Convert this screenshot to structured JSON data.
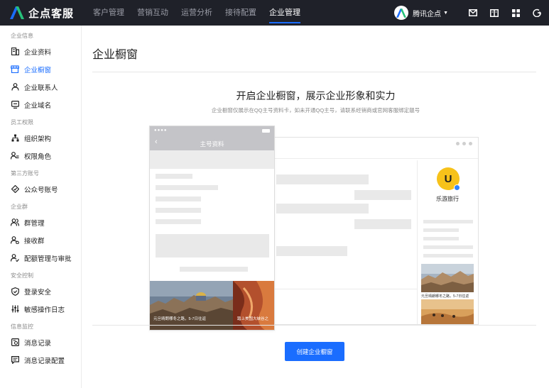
{
  "brand": {
    "name": "企点客服"
  },
  "nav": [
    {
      "label": "客户管理",
      "active": false
    },
    {
      "label": "营销互动",
      "active": false
    },
    {
      "label": "运营分析",
      "active": false
    },
    {
      "label": "接待配置",
      "active": false
    },
    {
      "label": "企业管理",
      "active": true
    }
  ],
  "account": {
    "name": "腾讯企点"
  },
  "top_icons": [
    "mail-icon",
    "book-icon",
    "grid-icon",
    "logout-icon"
  ],
  "sidebar": {
    "groups": [
      {
        "title": "企业信息",
        "items": [
          {
            "label": "企业资料",
            "icon": "profile-icon",
            "active": false
          },
          {
            "label": "企业橱窗",
            "icon": "storefront-icon",
            "active": true
          },
          {
            "label": "企业联系人",
            "icon": "contacts-icon",
            "active": false
          },
          {
            "label": "企业域名",
            "icon": "domain-icon",
            "active": false
          }
        ]
      },
      {
        "title": "员工权限",
        "items": [
          {
            "label": "组织架构",
            "icon": "org-chart-icon",
            "active": false
          },
          {
            "label": "权限角色",
            "icon": "role-icon",
            "active": false
          }
        ]
      },
      {
        "title": "第三方账号",
        "items": [
          {
            "label": "公众号账号",
            "icon": "official-account-icon",
            "active": false
          }
        ]
      },
      {
        "title": "企业群",
        "items": [
          {
            "label": "群管理",
            "icon": "group-icon",
            "active": false
          },
          {
            "label": "接收群",
            "icon": "receive-group-icon",
            "active": false
          },
          {
            "label": "配额管理与审批",
            "icon": "quota-icon",
            "active": false
          }
        ]
      },
      {
        "title": "安全控制",
        "items": [
          {
            "label": "登录安全",
            "icon": "shield-icon",
            "active": false
          },
          {
            "label": "敏感操作日志",
            "icon": "log-icon",
            "active": false
          }
        ]
      },
      {
        "title": "信息监控",
        "items": [
          {
            "label": "消息记录",
            "icon": "message-record-icon",
            "active": false
          },
          {
            "label": "消息记录配置",
            "icon": "message-config-icon",
            "active": false
          }
        ]
      }
    ]
  },
  "main": {
    "title": "企业橱窗",
    "hero_title": "开启企业橱窗，展示企业形象和实力",
    "hero_subtitle": "企业橱窗仅展示在QQ主号资料卡，如未开通QQ主号，请联系经销商或官网客服绑定靓号",
    "phone_title": "主号资料",
    "card_name": "乐游旅行",
    "card_logo": "U",
    "card_caption": "元旦晴朗哪冬之路，5-7日往返",
    "strip_caption_1": "元旦晴朗哪冬之路，5-7日往返",
    "strip_caption_2": "踏上美国大峡谷之",
    "create_button": "创建企业橱窗"
  },
  "colors": {
    "topbar": "#1f2129",
    "accent": "#1a6dff",
    "brand_logo_blue": "#1a6dff",
    "brand_logo_green": "#27c07a"
  }
}
